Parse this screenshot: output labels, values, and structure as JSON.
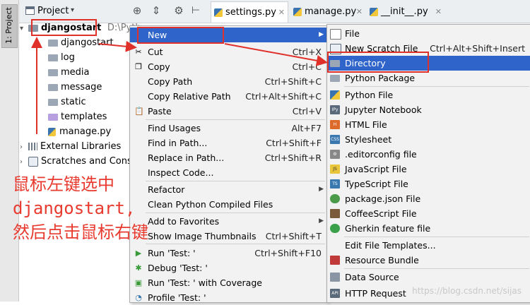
{
  "tool_stripe": {
    "label": "1: Project"
  },
  "project_panel": {
    "title": "Project",
    "tree": [
      {
        "label": "djangostart",
        "path": "D:\\Pyth",
        "expanded": true
      },
      {
        "label": "djangostart"
      },
      {
        "label": "log"
      },
      {
        "label": "media"
      },
      {
        "label": "message"
      },
      {
        "label": "static"
      },
      {
        "label": "templates"
      },
      {
        "label": "manage.py"
      },
      {
        "label": "External Libraries"
      },
      {
        "label": "Scratches and Conso"
      }
    ]
  },
  "tabs": [
    {
      "label": "settings.py"
    },
    {
      "label": "manage.py"
    },
    {
      "label": "__init__.py"
    }
  ],
  "context_menu": {
    "new": "New",
    "cut": {
      "label": "Cut",
      "shortcut": "Ctrl+X"
    },
    "copy": {
      "label": "Copy",
      "shortcut": "Ctrl+C"
    },
    "copy_path": {
      "label": "Copy Path",
      "shortcut": "Ctrl+Shift+C"
    },
    "copy_relative_path": {
      "label": "Copy Relative Path",
      "shortcut": "Ctrl+Alt+Shift+C"
    },
    "paste": {
      "label": "Paste",
      "shortcut": "Ctrl+V"
    },
    "find_usages": {
      "label": "Find Usages",
      "shortcut": "Alt+F7"
    },
    "find_in_path": {
      "label": "Find in Path...",
      "shortcut": "Ctrl+Shift+F"
    },
    "replace_in_path": {
      "label": "Replace in Path...",
      "shortcut": "Ctrl+Shift+R"
    },
    "inspect_code": {
      "label": "Inspect Code..."
    },
    "refactor": {
      "label": "Refactor"
    },
    "clean_compiled": {
      "label": "Clean Python Compiled Files"
    },
    "add_to_favorites": {
      "label": "Add to Favorites"
    },
    "show_thumbnails": {
      "label": "Show Image Thumbnails",
      "shortcut": "Ctrl+Shift+T"
    },
    "run": {
      "label": "Run 'Test: '",
      "shortcut": "Ctrl+Shift+F10"
    },
    "debug": {
      "label": "Debug 'Test: '"
    },
    "run_coverage": {
      "label": "Run 'Test: ' with Coverage"
    },
    "profile": {
      "label": "Profile 'Test: '"
    }
  },
  "new_submenu": [
    {
      "label": "File"
    },
    {
      "label": "New Scratch File",
      "shortcut": "Ctrl+Alt+Shift+Insert"
    },
    {
      "label": "Directory"
    },
    {
      "label": "Python Package"
    },
    {
      "label": "Python File"
    },
    {
      "label": "Jupyter Notebook"
    },
    {
      "label": "HTML File"
    },
    {
      "label": "Stylesheet"
    },
    {
      "label": ".editorconfig file"
    },
    {
      "label": "JavaScript File"
    },
    {
      "label": "TypeScript File"
    },
    {
      "label": "package.json File"
    },
    {
      "label": "CoffeeScript File"
    },
    {
      "label": "Gherkin feature file"
    },
    {
      "label": "Edit File Templates..."
    },
    {
      "label": "Resource Bundle"
    },
    {
      "label": "Data Source"
    },
    {
      "label": "HTTP Request"
    }
  ],
  "annotation": {
    "line1": "鼠标左键选中",
    "line2": "djangostart,",
    "line3": "然后点击鼠标右键"
  },
  "watermark": "https://blog.csdn.net/sijas",
  "colors": {
    "highlight": "#2f65ca",
    "annotation_red": "#e0302a",
    "menu_bg": "#f2f2f2"
  }
}
